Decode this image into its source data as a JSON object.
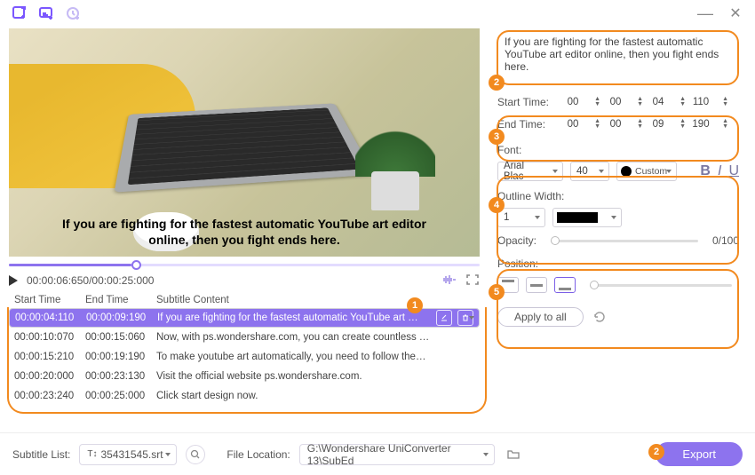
{
  "titlebar": {
    "icons": [
      "add-media",
      "add-sub",
      "recent"
    ],
    "win": [
      "min",
      "close"
    ]
  },
  "preview": {
    "overlay": "If you are fighting for the fastest automatic YouTube art editor online, then you fight ends here.",
    "time": "00:00:06:650/00:00:25:000",
    "progress_pct": 26
  },
  "columns": {
    "c1": "Start Time",
    "c2": "End Time",
    "c3": "Subtitle Content"
  },
  "rows": [
    {
      "start": "00:00:04:110",
      "end": "00:00:09:190",
      "text": "If you are fighting for the fastest automatic YouTube art editor online, th...",
      "selected": true
    },
    {
      "start": "00:00:10:070",
      "end": "00:00:15:060",
      "text": "Now, with ps.wondershare.com, you can create countless YouTube Cha..."
    },
    {
      "start": "00:00:15:210",
      "end": "00:00:19:190",
      "text": "To make youtube art automatically, you need to follow these steps:"
    },
    {
      "start": "00:00:20:000",
      "end": "00:00:23:130",
      "text": "Visit the official website ps.wondershare.com."
    },
    {
      "start": "00:00:23:240",
      "end": "00:00:25:000",
      "text": "Click start design now."
    }
  ],
  "editor": {
    "text": "If you are fighting for the fastest automatic YouTube art editor online, then you fight ends here.",
    "start_label": "Start Time:",
    "end_label": "End Time:",
    "start": [
      "00",
      "00",
      "04",
      "110"
    ],
    "end": [
      "00",
      "00",
      "09",
      "190"
    ]
  },
  "font": {
    "label": "Font:",
    "family": "Arial Blac",
    "size": "40",
    "color_label": "Custom",
    "color": "#000000",
    "outline_label": "Outline Width:",
    "outline_width": "1",
    "outline_color": "#000000",
    "bold": "B",
    "italic": "I",
    "underline": "U"
  },
  "opacity": {
    "label": "Opacity:",
    "value": "0/100"
  },
  "position": {
    "label": "Position:"
  },
  "apply_all": "Apply to all",
  "footer": {
    "list_label": "Subtitle List:",
    "file": "35431545.srt",
    "loc_label": "File Location:",
    "loc": "G:\\Wondershare UniConverter 13\\SubEd",
    "export": "Export"
  },
  "callouts": [
    "1",
    "2",
    "3",
    "4",
    "5",
    "2"
  ]
}
